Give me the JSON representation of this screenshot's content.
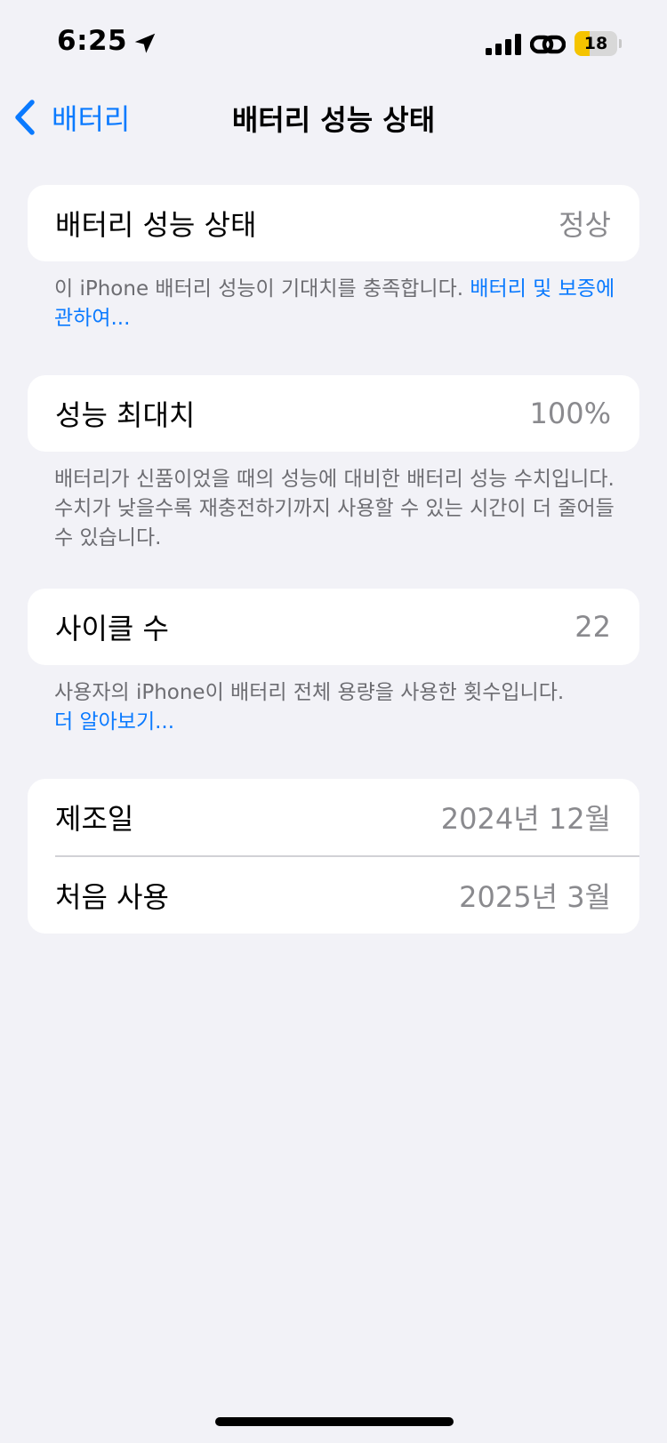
{
  "status_bar": {
    "time": "6:25",
    "battery_level": "18",
    "battery_fraction": 0.18,
    "icons": [
      "location-arrow-icon",
      "cellular-signal-icon",
      "link-icon",
      "battery-icon"
    ],
    "colors": {
      "battery_fill": "#f5c400"
    }
  },
  "nav": {
    "back_label": "배터리",
    "title": "배터리 성능 상태"
  },
  "health": {
    "label": "배터리 성능 상태",
    "value": "정상",
    "note": "이 iPhone 배터리 성능이 기대치를 충족합니다. ",
    "note_link": "배터리 및 보증에 관하여..."
  },
  "max_capacity": {
    "label": "성능 최대치",
    "value": "100%",
    "note": "배터리가 신품이었을 때의 성능에 대비한 배터리 성능 수치입니다. 수치가 낮을수록 재충전하기까지 사용할 수 있는 시간이 더 줄어들 수 있습니다."
  },
  "cycle_count": {
    "label": "사이클 수",
    "value": "22",
    "note": "사용자의 iPhone이 배터리 전체 용량을 사용한 횟수입니다.",
    "note_link": "더 알아보기..."
  },
  "dates": {
    "manufacture_label": "제조일",
    "manufacture_value": "2024년 12월",
    "first_use_label": "처음 사용",
    "first_use_value": "2025년 3월"
  },
  "colors": {
    "accent": "#0a7aff",
    "background": "#f2f2f7",
    "secondary_text": "#8a8a8e"
  }
}
